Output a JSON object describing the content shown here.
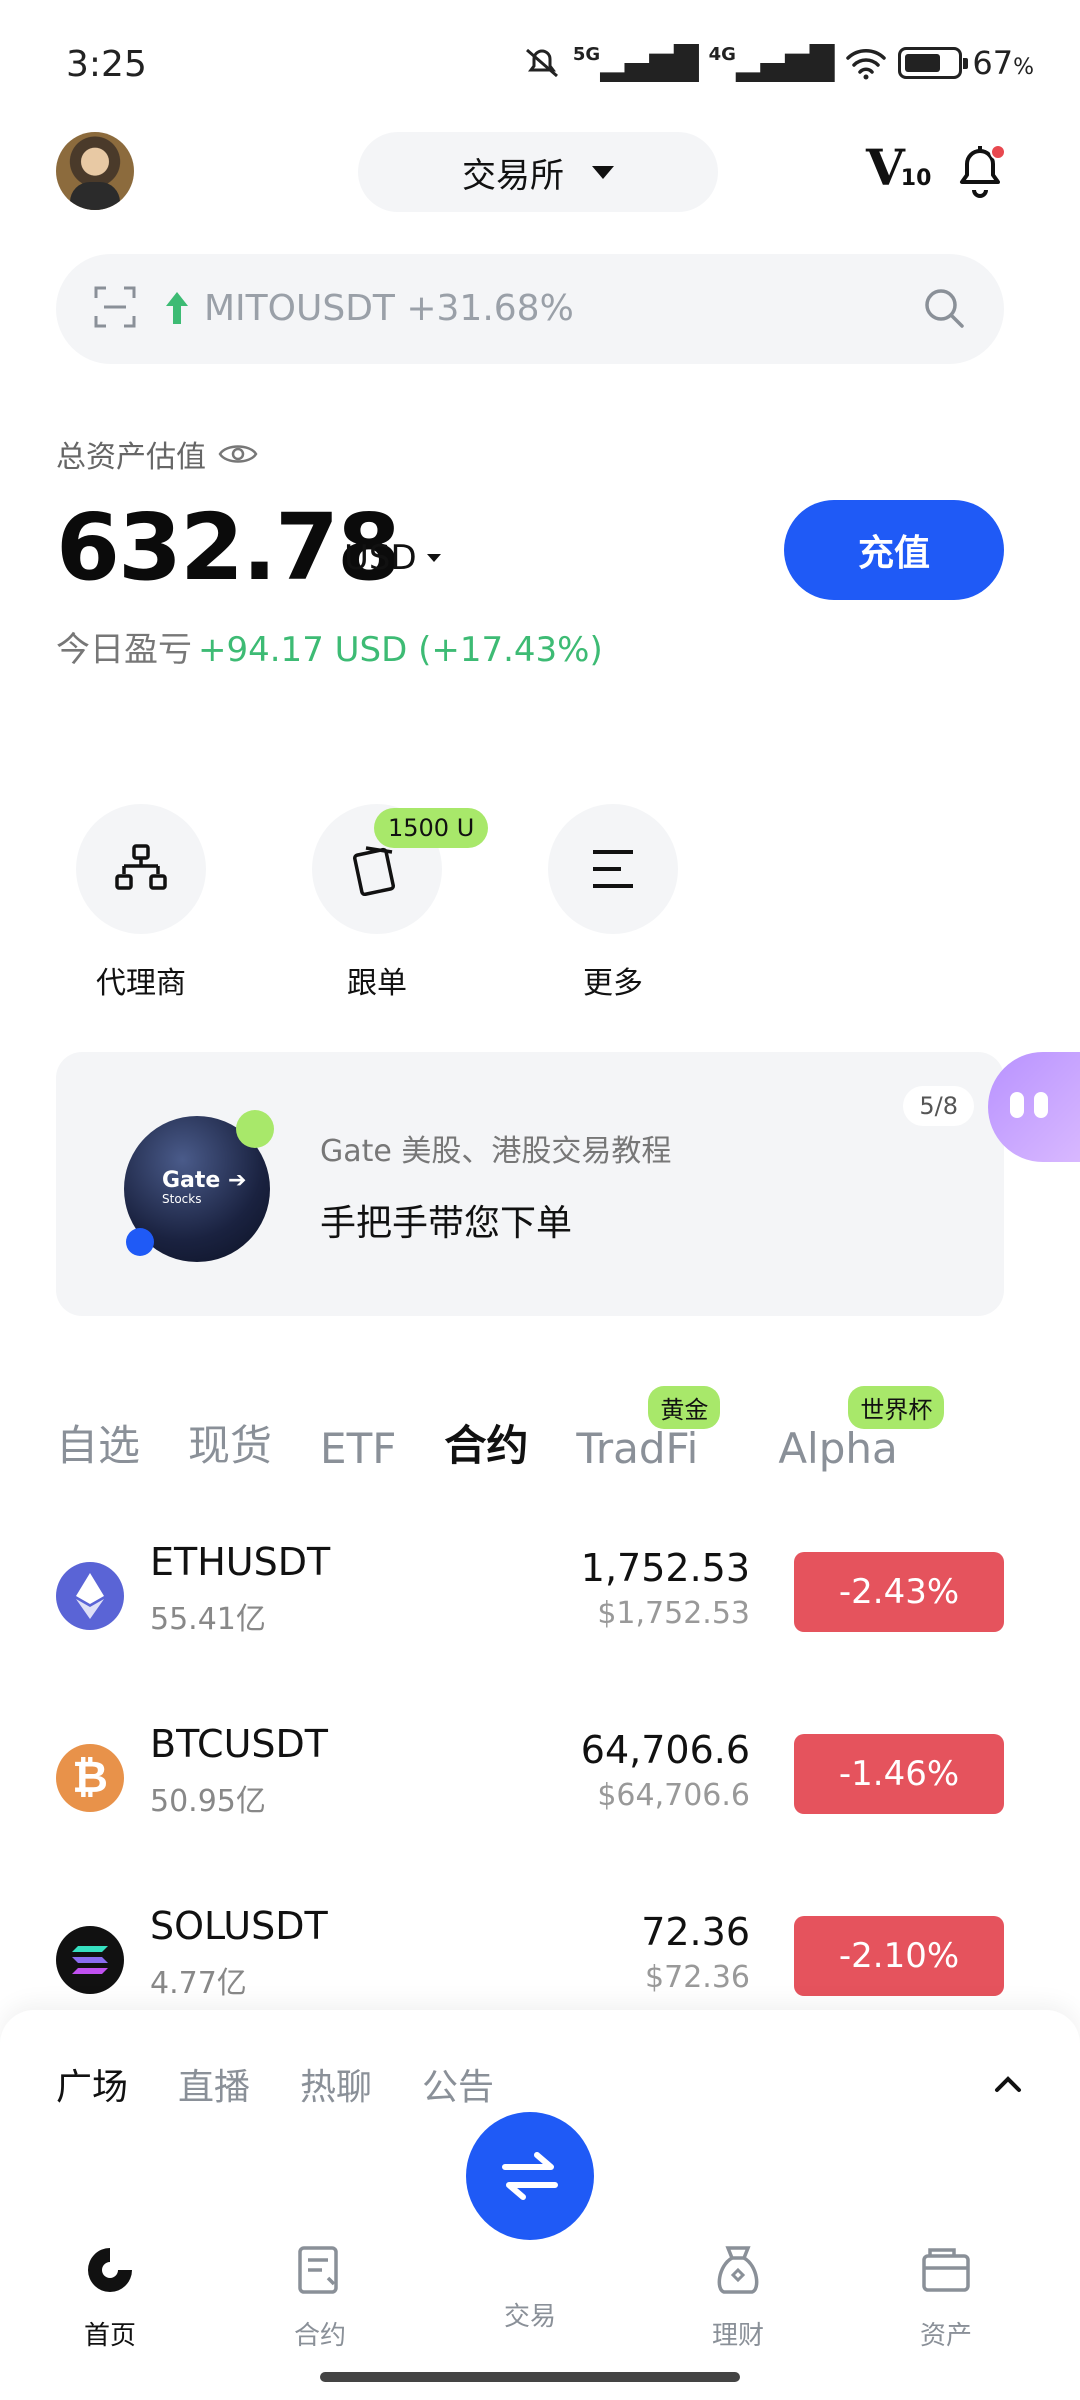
{
  "status_bar": {
    "time": "3:25",
    "net1": "5G",
    "net2": "4G",
    "battery": "67",
    "battery_unit": "%"
  },
  "header": {
    "exchange_label": "交易所",
    "vip_level": "V",
    "vip_num": "10"
  },
  "search": {
    "ticker": "MITOUSDT +31.68%"
  },
  "assets": {
    "label": "总资产估值",
    "total": "632.78",
    "unit": "USD",
    "deposit_label": "充值",
    "pnl_label": "今日盈亏",
    "pnl_value": "+94.17 USD (+17.43%)"
  },
  "quick_actions": [
    {
      "label": "代理商",
      "icon": "agent-icon"
    },
    {
      "label": "跟单",
      "icon": "copy-trade-icon",
      "badge": "1500 U"
    },
    {
      "label": "更多",
      "icon": "menu-icon"
    }
  ],
  "banner": {
    "subtitle": "Gate 美股、港股交易教程",
    "title": "手把手带您下单",
    "page": "5/8",
    "img_text": "Gate",
    "img_sub": "Stocks"
  },
  "market_tabs": [
    {
      "label": "自选"
    },
    {
      "label": "现货"
    },
    {
      "label": "ETF"
    },
    {
      "label": "合约",
      "active": true
    },
    {
      "label": "TradFi",
      "badge": "黄金"
    },
    {
      "label": "Alpha",
      "badge": "世界杯"
    }
  ],
  "markets": [
    {
      "pair": "ETHUSDT",
      "volume": "55.41亿",
      "price": "1,752.53",
      "fiat": "$1,752.53",
      "change": "-2.43%",
      "coin_color": "#5a64d6"
    },
    {
      "pair": "BTCUSDT",
      "volume": "50.95亿",
      "price": "64,706.6",
      "fiat": "$64,706.6",
      "change": "-1.46%",
      "coin_color": "#e8924a"
    },
    {
      "pair": "SOLUSDT",
      "volume": "4.77亿",
      "price": "72.36",
      "fiat": "$72.36",
      "change": "-2.10%",
      "coin_color": "#111111"
    }
  ],
  "feed_tabs": [
    "广场",
    "直播",
    "热聊",
    "公告"
  ],
  "nav": {
    "home": "首页",
    "futures": "合约",
    "trade": "交易",
    "earn": "理财",
    "assets": "资产"
  },
  "colors": {
    "accent": "#1f5af6",
    "up": "#3dbb74",
    "down": "#e5535d",
    "badge": "#a8e86a"
  }
}
